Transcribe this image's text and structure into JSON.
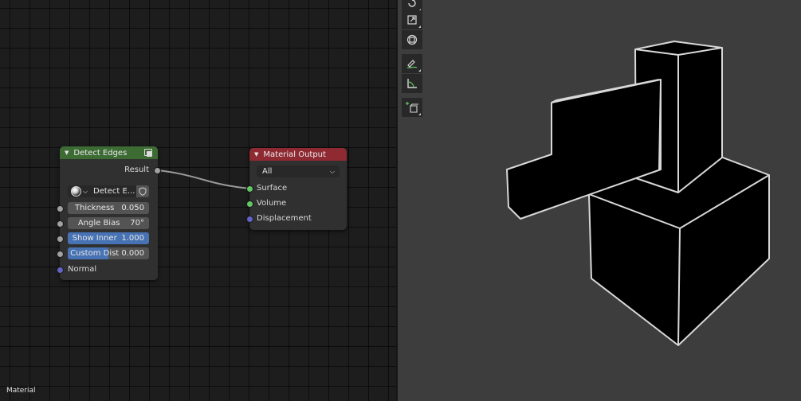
{
  "node_editor": {
    "editor_label": "Material",
    "detect_edges_node": {
      "title": "Detect Edges",
      "header_color": "#3c6b34",
      "output_socket": "Result",
      "mode_value": "Detect E...",
      "inputs": [
        {
          "label": "Thickness",
          "value": "0.050",
          "fill": 0
        },
        {
          "label": "Angle Bias",
          "value": "70°",
          "fill": 0
        },
        {
          "label": "Show Inner",
          "value": "1.000",
          "fill": 1.0
        },
        {
          "label": "Custom Dist",
          "value": "0.000",
          "fill": 0.5
        }
      ],
      "normal_socket": "Normal"
    },
    "material_output_node": {
      "title": "Material Output",
      "header_color": "#8f2a33",
      "target_value": "All",
      "inputs": [
        "Surface",
        "Volume",
        "Displacement"
      ]
    }
  },
  "viewport": {
    "background_color": "#3d3d3d",
    "tools": [
      "rotate-tool",
      "scale-tool",
      "transform-tool",
      "annotate-tool",
      "measure-tool",
      "add-cube-tool"
    ]
  }
}
